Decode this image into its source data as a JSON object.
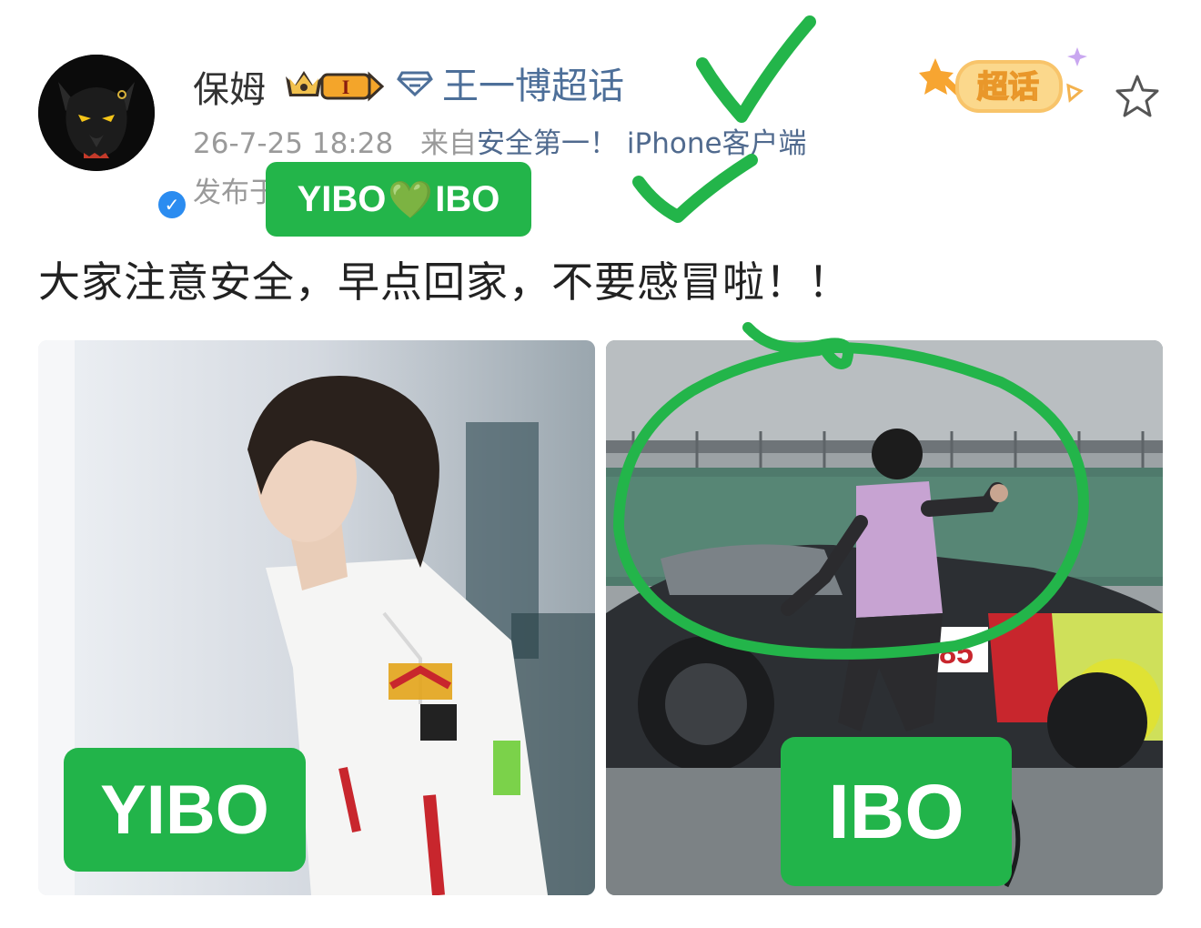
{
  "post": {
    "username": "保姆",
    "level_badge": "I",
    "topic": "王一博超话",
    "timestamp": "26-7-25 18:28",
    "source_prefix": "来自",
    "source": "安全第一！ iPhone客户端",
    "location": "发布于",
    "text": "大家注意安全，早点回家，不要感冒啦！！",
    "chaohua_badge": "超话"
  },
  "annotation": {
    "tag_left": "YIBO",
    "tag_heart": "💚",
    "tag_right": "IBO",
    "green": "#23b54a"
  },
  "photos": [
    {
      "label": "YIBO"
    },
    {
      "label": "IBO"
    }
  ],
  "icons": [
    "crown-icon",
    "diamond-icon",
    "verified-icon",
    "star-icon",
    "checkmark-icon"
  ],
  "colors": {
    "link": "#4d6f99",
    "meta": "#9a9a9a",
    "accent_green": "#23b54a"
  }
}
